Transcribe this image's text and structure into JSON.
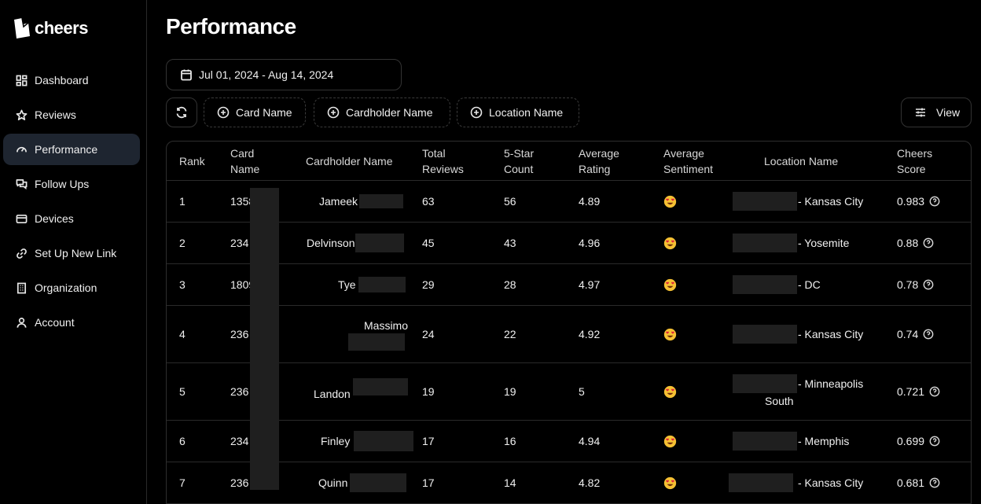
{
  "app": {
    "name": "cheers"
  },
  "sidebar": {
    "items": [
      {
        "label": "Dashboard",
        "icon": "dashboard-icon",
        "active": false
      },
      {
        "label": "Reviews",
        "icon": "star-icon",
        "active": false
      },
      {
        "label": "Performance",
        "icon": "gauge-icon",
        "active": true
      },
      {
        "label": "Follow Ups",
        "icon": "chat-icon",
        "active": false
      },
      {
        "label": "Devices",
        "icon": "card-icon",
        "active": false
      },
      {
        "label": "Set Up New Link",
        "icon": "link-icon",
        "active": false
      },
      {
        "label": "Organization",
        "icon": "building-icon",
        "active": false
      },
      {
        "label": "Account",
        "icon": "user-icon",
        "active": false
      }
    ]
  },
  "page": {
    "title": "Performance"
  },
  "filters": {
    "date_range": "Jul 01, 2024 - Aug 14, 2024",
    "card_name": "Card Name",
    "cardholder_name": "Cardholder Name",
    "location_name": "Location Name",
    "view": "View"
  },
  "table": {
    "headers": {
      "rank": "Rank",
      "card_name_1": "Card",
      "card_name_2": "Name",
      "cardholder": "Cardholder Name",
      "total_1": "Total",
      "total_2": "Reviews",
      "five_1": "5-Star",
      "five_2": "Count",
      "avg_rating_1": "Average",
      "avg_rating_2": "Rating",
      "avg_sent_1": "Average",
      "avg_sent_2": "Sentiment",
      "location": "Location Name",
      "score_1": "Cheers",
      "score_2": "Score"
    },
    "rows": [
      {
        "rank": "1",
        "card": "1358",
        "cardholder": "Jameek",
        "total": "63",
        "five": "56",
        "avg": "4.89",
        "location": "- Kansas City",
        "score": "0.983"
      },
      {
        "rank": "2",
        "card": "234",
        "cardholder": "Delvinson",
        "total": "45",
        "five": "43",
        "avg": "4.96",
        "location": "- Yosemite",
        "score": "0.88"
      },
      {
        "rank": "3",
        "card": "1809",
        "cardholder": "Tye",
        "total": "29",
        "five": "28",
        "avg": "4.97",
        "location": "- DC",
        "score": "0.78"
      },
      {
        "rank": "4",
        "card": "236",
        "cardholder": "Massimo",
        "total": "24",
        "five": "22",
        "avg": "4.92",
        "location": "- Kansas City",
        "score": "0.74"
      },
      {
        "rank": "5",
        "card": "236",
        "cardholder": "Landon",
        "total": "19",
        "five": "19",
        "avg": "5",
        "location": "- Minneapolis",
        "location_2": "South",
        "score": "0.721"
      },
      {
        "rank": "6",
        "card": "234",
        "cardholder": "Finley",
        "total": "17",
        "five": "16",
        "avg": "4.94",
        "location": "- Memphis",
        "score": "0.699"
      },
      {
        "rank": "7",
        "card": "236",
        "cardholder": "Quinn",
        "total": "17",
        "five": "14",
        "avg": "4.82",
        "location": "- Kansas City",
        "score": "0.681"
      }
    ]
  }
}
